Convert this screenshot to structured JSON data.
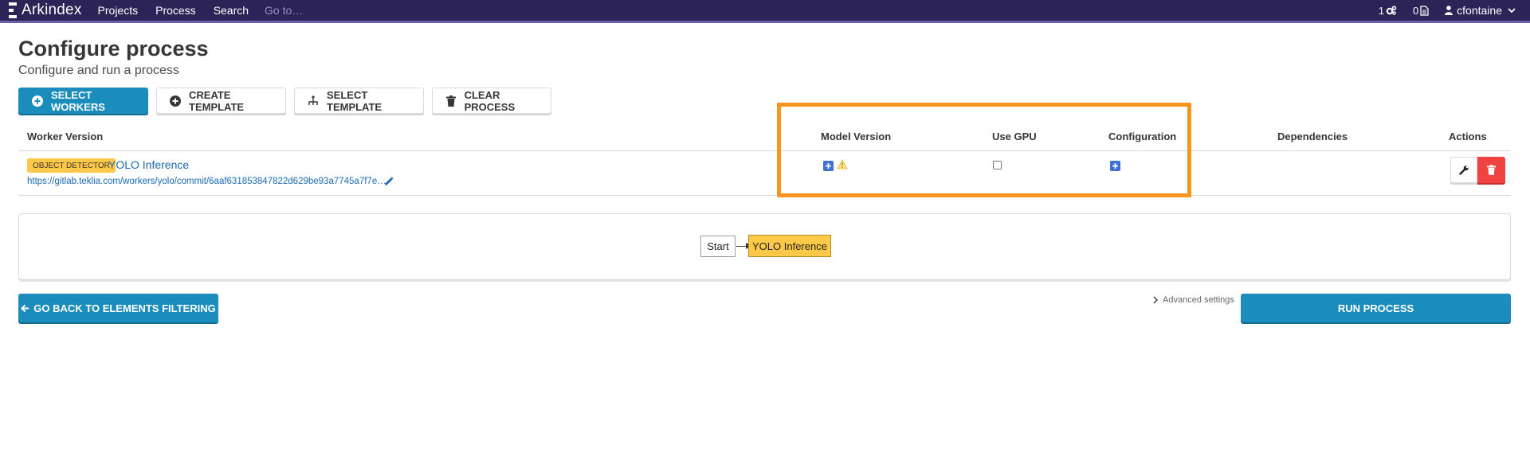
{
  "navbar": {
    "brand": "Arkindex",
    "links": [
      "Projects",
      "Process",
      "Search"
    ],
    "goto_placeholder": "Go to…",
    "tasks_count": "1",
    "files_count": "0",
    "username": "cfontaine"
  },
  "header": {
    "title": "Configure process",
    "subtitle": "Configure and run a process"
  },
  "toolbar": {
    "select_workers": "SELECT WORKERS",
    "create_template": "CREATE TEMPLATE",
    "select_template": "SELECT TEMPLATE",
    "clear_process": "CLEAR PROCESS"
  },
  "table": {
    "columns": {
      "worker_version": "Worker Version",
      "model_version": "Model Version",
      "use_gpu": "Use GPU",
      "configuration": "Configuration",
      "dependencies": "Dependencies",
      "actions": "Actions"
    },
    "rows": [
      {
        "type_tag": "OBJECT DETECTOR",
        "name": "YOLO Inference",
        "url": "https://gitlab.teklia.com/workers/yolo/commit/6aaf631853847822d629be93a7745a7f7e…",
        "use_gpu": false
      }
    ]
  },
  "graph": {
    "start_label": "Start",
    "node_label": "YOLO Inference"
  },
  "footer": {
    "back_button": "GO BACK TO ELEMENTS FILTERING",
    "advanced_settings": "Advanced settings",
    "run_button": "RUN PROCESS"
  },
  "colors": {
    "navbar": "#2c2357",
    "primary": "#1b8dbd",
    "tag": "#ffc947",
    "danger": "#f14242",
    "highlight": "#f7941d",
    "link": "#1b6ab0"
  }
}
